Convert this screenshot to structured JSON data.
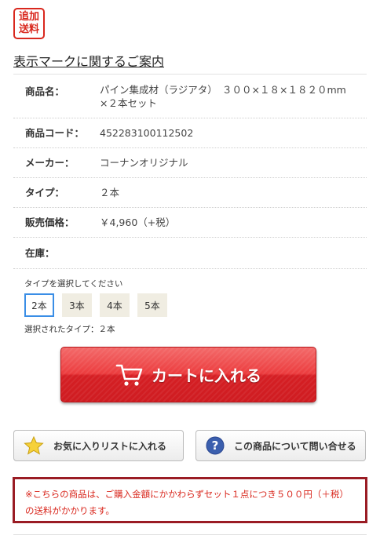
{
  "badge": {
    "line1": "追加",
    "line2": "送料"
  },
  "notice_link": "表示マークに関するご案内",
  "specs": {
    "name": {
      "label": "商品名：",
      "value": "パイン集成材（ラジアタ）　３００×１８×１８２０mm　×２本セット"
    },
    "code": {
      "label": "商品コード：",
      "value": "452283100112502"
    },
    "maker": {
      "label": "メーカー：",
      "value": "コーナンオリジナル"
    },
    "type": {
      "label": "タイプ：",
      "value": "２本"
    },
    "price": {
      "label": "販売価格：",
      "value": "￥4,960（+税）"
    },
    "stock": {
      "label": "在庫：",
      "value": ""
    }
  },
  "type_selector": {
    "caption": "タイプを選択してください",
    "options": [
      "2本",
      "3本",
      "4本",
      "5本"
    ],
    "selected_index": 0,
    "selected_text": "選択されたタイプ：２本"
  },
  "cart_button": {
    "label": "カートに入れる",
    "icon": "cart-icon"
  },
  "favorite_button": {
    "label": "お気に入りリストに入れる",
    "icon": "star-icon"
  },
  "inquiry_button": {
    "label": "この商品について問い合せる",
    "icon": "question-icon"
  },
  "shipping_note": "※こちらの商品は、ご購入金額にかかわらずセット１点につき５００円（＋税）の送料がかかります。",
  "colors": {
    "accent_red": "#d9281e",
    "selected_border": "#3a8ee6",
    "note_border": "#9a1c24"
  }
}
